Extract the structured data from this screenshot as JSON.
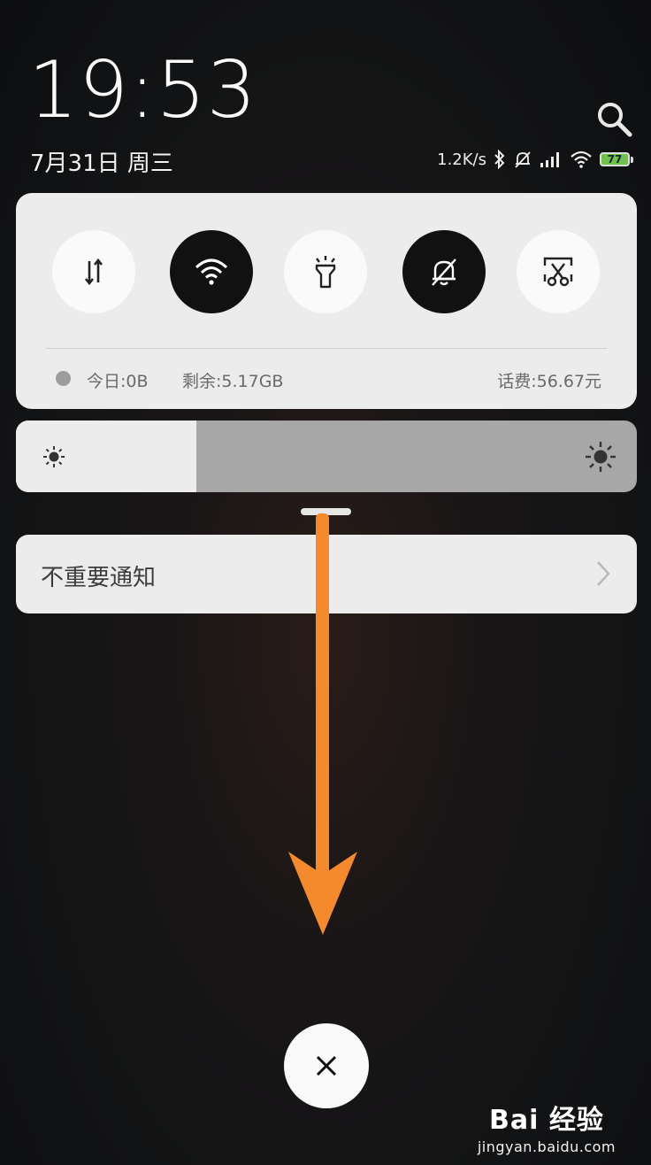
{
  "lockscreen": {
    "time": "19:53",
    "date": "7月31日 周三"
  },
  "status_bar": {
    "net_speed": "1.2K/s",
    "battery_level": "77",
    "icons": [
      "bluetooth-icon",
      "bell-muted-icon",
      "signal-icon",
      "wifi-icon",
      "battery-icon"
    ]
  },
  "quick_toggles": [
    {
      "name": "mobile-data",
      "icon": "data-arrows-icon",
      "state": "off"
    },
    {
      "name": "wifi",
      "icon": "wifi-icon",
      "state": "on"
    },
    {
      "name": "flashlight",
      "icon": "flashlight-icon",
      "state": "off"
    },
    {
      "name": "silent",
      "icon": "bell-muted-icon",
      "state": "on"
    },
    {
      "name": "screenshot",
      "icon": "screenshot-scissors-icon",
      "state": "off"
    }
  ],
  "data_usage": {
    "today": "今日:0B",
    "remaining": "剩余:5.17GB",
    "balance": "话费:56.67元"
  },
  "brightness": {
    "level_fraction": 0.29
  },
  "notification": {
    "label": "不重要通知"
  },
  "colors": {
    "annotation_arrow": "#f58a2c",
    "toggle_on": "#111111",
    "toggle_off": "#fafafa",
    "panel": "#ececec"
  },
  "watermark": {
    "brand": "Bai 经验",
    "url": "jingyan.baidu.com"
  }
}
